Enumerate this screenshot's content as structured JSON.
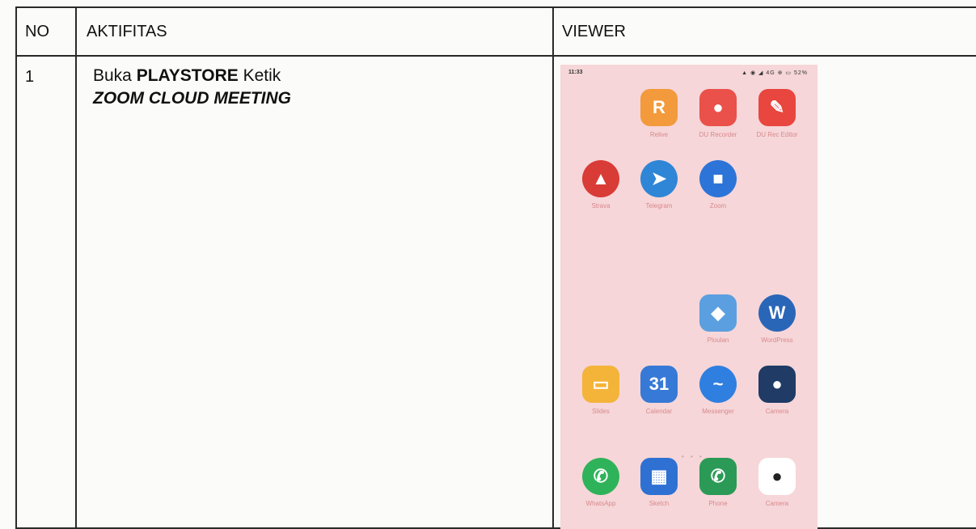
{
  "table": {
    "headers": [
      "NO",
      "AKTIFITAS",
      "VIEWER"
    ],
    "row": {
      "no": "1",
      "activity": {
        "prefix": "Buka ",
        "bold": "PLAYSTORE",
        "suffix": " Ketik",
        "line2": "ZOOM CLOUD MEETING"
      }
    }
  },
  "phone": {
    "time": "11:33",
    "status_icons": "▲ ◉ ◢ 4G ⊕ ▭ 52%",
    "apps": [
      {
        "label": "Relive",
        "icon": "relive-icon",
        "color": "#f39a3c",
        "glyph": "R",
        "round": false
      },
      {
        "label": "DU Recorder",
        "icon": "du-recorder-icon",
        "color": "#e9514a",
        "glyph": "●",
        "round": false
      },
      {
        "label": "DU Rec Editor",
        "icon": "du-editor-icon",
        "color": "#e8463f",
        "glyph": "✎",
        "round": false
      },
      {
        "label": "Strava",
        "icon": "strava-icon",
        "color": "#d93b36",
        "glyph": "▲",
        "round": true
      },
      {
        "label": "Telegram",
        "icon": "telegram-icon",
        "color": "#2f86d6",
        "glyph": "➤",
        "round": true
      },
      {
        "label": "Zoom",
        "icon": "zoom-icon",
        "color": "#2d74d8",
        "glyph": "■",
        "round": true
      },
      {
        "label": "Ploulan",
        "icon": "ploulan-icon",
        "color": "#5b9fe0",
        "glyph": "◆",
        "round": false
      },
      {
        "label": "WordPress",
        "icon": "wordpress-icon",
        "color": "#2a66b8",
        "glyph": "W",
        "round": true
      },
      {
        "label": "Slides",
        "icon": "slides-icon",
        "color": "#f4b43a",
        "glyph": "▭",
        "round": false
      },
      {
        "label": "Calendar",
        "icon": "calendar-icon",
        "color": "#3779d6",
        "glyph": "31",
        "round": false
      },
      {
        "label": "Messenger",
        "icon": "messenger-icon",
        "color": "#2f7fe0",
        "glyph": "~",
        "round": true
      },
      {
        "label": "Camera",
        "icon": "camera-icon",
        "color": "#1f3b66",
        "glyph": "●",
        "round": false
      },
      {
        "label": "WhatsApp",
        "icon": "whatsapp-icon",
        "color": "#2fb35a",
        "glyph": "✆",
        "round": true
      },
      {
        "label": "Sketch",
        "icon": "sketch-icon",
        "color": "#2e71d3",
        "glyph": "▦",
        "round": false
      },
      {
        "label": "Phone",
        "icon": "phone-icon",
        "color": "#2b9a56",
        "glyph": "✆",
        "round": false
      },
      {
        "label": "Camera",
        "icon": "camera-dock-icon",
        "color": "#ffffff",
        "glyph": "●",
        "round": false
      }
    ]
  }
}
